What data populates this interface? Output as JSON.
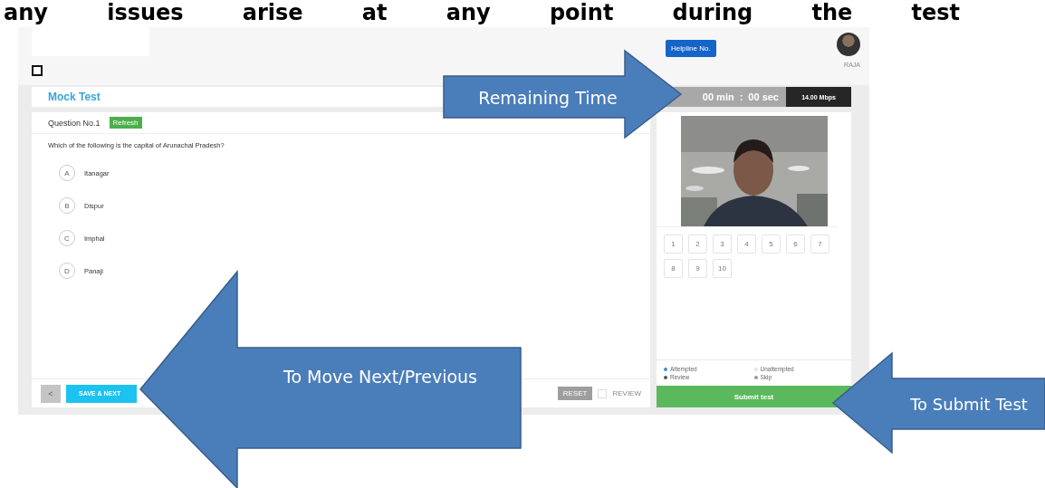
{
  "heading": "any issues arise at any point during the test",
  "header": {
    "checkbox": {
      "checked": false
    },
    "helpline_button": "Helpline No.",
    "user_name": "RAJA"
  },
  "title": "Mock Test",
  "timer": {
    "minutes": "00 min",
    "separator": ":",
    "seconds": "00 sec",
    "speed": "14.00 Mbps"
  },
  "question": {
    "number": "Question No.1",
    "badge": "Refresh",
    "text": "Which of the following is the capital of Arunachal Pradesh?",
    "options": [
      {
        "letter": "A",
        "label": "Itanagar",
        "selected": false
      },
      {
        "letter": "B",
        "label": "Dispur",
        "selected": false
      },
      {
        "letter": "C",
        "label": "Imphal",
        "selected": false
      },
      {
        "letter": "D",
        "label": "Panaji",
        "selected": false
      }
    ]
  },
  "footer": {
    "previous": "<",
    "save_next": "SAVE & NEXT",
    "reset": "RESET",
    "review": {
      "label": "REVIEW",
      "checked": false
    }
  },
  "sidebar": {
    "palette": [
      "1",
      "2",
      "3",
      "4",
      "5",
      "6",
      "7",
      "8",
      "9",
      "10"
    ],
    "legend": [
      {
        "label": "Attempted",
        "color": "#3a8fd0"
      },
      {
        "label": "Unattempted",
        "color": "#e4e4e4"
      },
      {
        "label": "Review",
        "color": "#555555"
      },
      {
        "label": "Skip",
        "color": "#9a9a9a"
      }
    ],
    "submit": "Submit test"
  },
  "annotations": [
    {
      "kind": "right",
      "label": "Remaining Time"
    },
    {
      "kind": "left",
      "label": "To Move Next/Previous"
    },
    {
      "kind": "left",
      "label": "To Submit Test"
    }
  ]
}
